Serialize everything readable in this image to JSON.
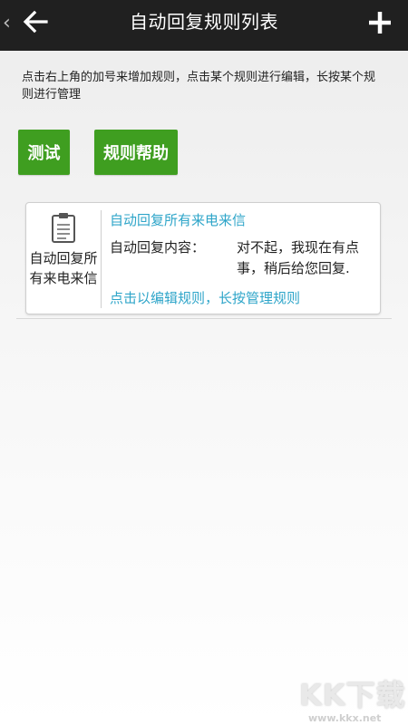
{
  "app_bar": {
    "title": "自动回复规则列表"
  },
  "hint_text": "点击右上角的加号来增加规则，点击某个规则进行编辑，长按某个规则进行管理",
  "buttons": {
    "test_label": "测试",
    "help_label": "规则帮助"
  },
  "rules": [
    {
      "name_left": "自动回复所有来电来信",
      "name_right": "自动回复所有来电来信",
      "content_label": "自动回复内容：",
      "content_text": "对不起，我现在有点事，稍后给您回复.",
      "footer": "点击以编辑规则，长按管理规则"
    }
  ],
  "watermark": {
    "text": "KK下载",
    "url": "www.kkx.net"
  },
  "icons": {
    "back": "back-arrow-icon",
    "add": "plus-icon",
    "rule": "clipboard-icon",
    "edge": "chevron-left-icon"
  },
  "colors": {
    "app_bar": "#202020",
    "button_green": "#3f9e20",
    "link_blue": "#2ea5c9"
  }
}
